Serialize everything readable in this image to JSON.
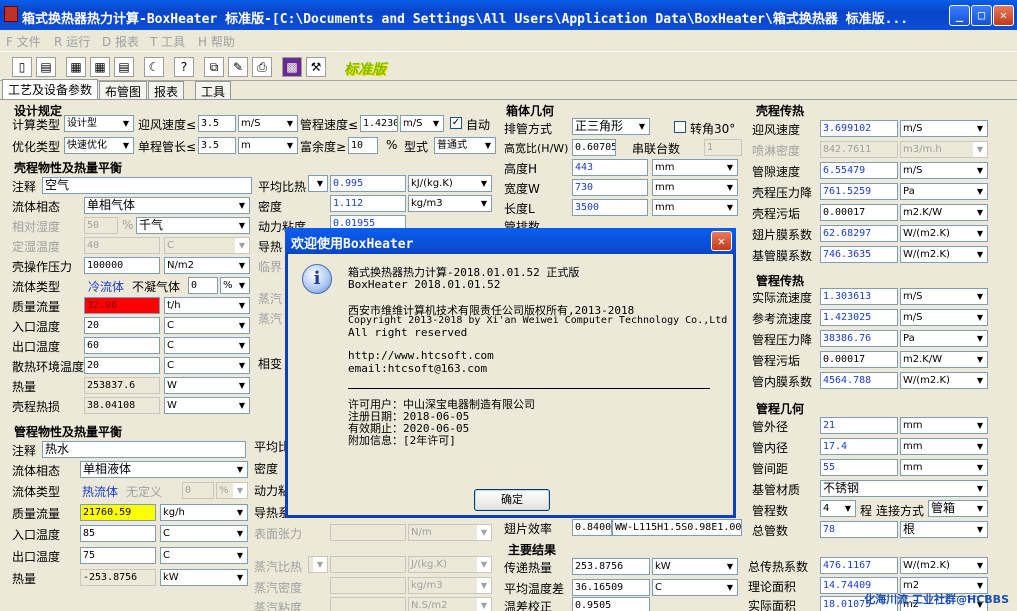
{
  "window": {
    "title": "箱式换热器热力计算-BoxHeater 标准版-[C:\\Documents and Settings\\All Users\\Application Data\\BoxHeater\\箱式换热器 标准版..."
  },
  "menu": [
    "F 文件",
    "R 运行",
    "D 报表",
    "T 工具",
    "H 帮助"
  ],
  "toolbar": {
    "badge": "标准版"
  },
  "tabs": [
    "工艺及设备参数",
    "布管图",
    "报表",
    "工具"
  ],
  "design": {
    "title": "设计规定",
    "calc_type_label": "计算类型",
    "calc_type": "设计型",
    "air_speed_label": "迎风速度≤",
    "air_speed": "3.5",
    "air_speed_unit": "m/S",
    "tube_speed_label": "管程速度≤",
    "tube_speed": "1.42302",
    "tube_speed_unit": "m/S",
    "auto_label": "自动",
    "auto_check": "✓",
    "opt_type_label": "优化类型",
    "opt_type": "快速优化",
    "single_len_label": "单程管长≤",
    "single_len": "3.5",
    "single_len_unit": "m",
    "margin_label": "富余度≥",
    "margin": "10",
    "margin_unit": "%",
    "model_label": "型式",
    "model": "普通式"
  },
  "shell": {
    "title": "壳程物性及热量平衡",
    "note_label": "注释",
    "note": "空气",
    "phase_label": "流体相态",
    "phase": "单相气体",
    "rh_label": "相对湿度",
    "rh": "50",
    "rh_unit": "%",
    "rh_sel": "千气",
    "fixed_temp_label": "定湿温度",
    "fixed_temp": "40",
    "fixed_temp_unit": "C",
    "pressure_label": "壳操作压力",
    "pressure": "100000",
    "pressure_unit": "N/m2",
    "fluid_type_label": "流体类型",
    "fluid_type": "冷流体",
    "noncond_label": "不凝气体",
    "noncond": "0",
    "noncond_unit": "%",
    "mass_flow_label": "质量流量",
    "mass_flow": "32.96",
    "mass_flow_unit": "t/h",
    "in_temp_label": "入口温度",
    "in_temp": "20",
    "in_temp_unit": "C",
    "out_temp_label": "出口温度",
    "out_temp": "60",
    "out_temp_unit": "C",
    "env_temp_label": "散热环境温度",
    "env_temp": "20",
    "env_temp_unit": "C",
    "heat_label": "热量",
    "heat": "253837.6",
    "heat_unit": "W",
    "loss_label": "壳程热损",
    "loss": "38.04108",
    "loss_unit": "W",
    "cp_label": "平均比热",
    "cp": "0.995",
    "cp_unit": "kJ/(kg.K)",
    "density_label": "密度",
    "density": "1.112",
    "density_unit": "kg/m3",
    "visc_label": "动力粘度",
    "visc": "0.01955",
    "cond_label": "导热",
    "crit_label": "临界",
    "steam1_label": "蒸汽",
    "steam2_label": "蒸汽",
    "phase_change_label": "相变"
  },
  "tube": {
    "title": "管程物性及热量平衡",
    "note_label": "注释",
    "note": "热水",
    "phase_label": "流体相态",
    "phase": "单相液体",
    "fluid_type_label": "流体类型",
    "fluid_type": "热流体",
    "undefined_label": "无定义",
    "undefined_val": "0",
    "undefined_unit": "%",
    "mass_flow_label": "质量流量",
    "mass_flow": "21760.59",
    "mass_flow_unit": "kg/h",
    "in_temp_label": "入口温度",
    "in_temp": "85",
    "in_temp_unit": "C",
    "out_temp_label": "出口温度",
    "out_temp": "75",
    "out_temp_unit": "C",
    "heat_label": "热量",
    "heat": "-253.8756",
    "heat_unit": "kW",
    "cp_label": "平均比",
    "density_label": "密度",
    "visc_label": "动力粘",
    "cond_label": "导热系",
    "surface_label": "表面张力",
    "surface_unit": "N/m",
    "steam_cp_label": "蒸汽比热",
    "steam_cp_unit": "J/(kg.K)",
    "steam_density_label": "蒸汽密度",
    "steam_density_unit": "kg/m3",
    "steam_visc_label": "蒸汽粘度",
    "steam_visc_unit": "N.S/m2"
  },
  "box": {
    "title": "箱体几何",
    "arrange_label": "排管方式",
    "arrange": "正三角形",
    "rotate_label": "转角30°",
    "ratio_label": "高宽比(H/W)",
    "ratio": "0.607051",
    "series_label": "串联台数",
    "series": "1",
    "height_label": "高度H",
    "height": "443",
    "height_unit": "mm",
    "width_label": "宽度W",
    "width": "730",
    "width_unit": "mm",
    "length_label": "长度L",
    "length": "3500",
    "length_unit": "mm",
    "rows_label": "管排数",
    "fin_eff_label": "翅片效率",
    "fin_eff": "0.8400",
    "fin_model": "WW-L115H1.5S0.98E1.00"
  },
  "shell_heat": {
    "title": "壳程传热",
    "air_speed_label": "迎风速度",
    "air_speed": "3.699102",
    "air_speed_unit": "m/S",
    "spray_label": "喷淋密度",
    "spray": "842.7611",
    "spray_unit": "m3/m.h",
    "gap_speed_label": "管隙速度",
    "gap_speed": "6.55479",
    "gap_speed_unit": "m/S",
    "dp_label": "壳程压力降",
    "dp": "761.5259",
    "dp_unit": "Pa",
    "fouling_label": "壳程污垢",
    "fouling": "0.00017",
    "fouling_unit": "m2.K/W",
    "fin_coef_label": "翅片膜系数",
    "fin_coef": "62.68297",
    "fin_coef_unit": "W/(m2.K)",
    "base_coef_label": "基管膜系数",
    "base_coef": "746.3635",
    "base_coef_unit": "W/(m2.K)"
  },
  "tube_heat": {
    "title": "管程传热",
    "act_speed_label": "实际流速度",
    "act_speed": "1.303613",
    "act_speed_unit": "m/S",
    "ref_speed_label": "参考流速度",
    "ref_speed": "1.423025",
    "ref_speed_unit": "m/S",
    "dp_label": "管程压力降",
    "dp": "38386.76",
    "dp_unit": "Pa",
    "fouling_label": "管程污垢",
    "fouling": "0.00017",
    "fouling_unit": "m2.K/W",
    "inner_coef_label": "管内膜系数",
    "inner_coef": "4564.788",
    "inner_coef_unit": "W/(m2.K)"
  },
  "tube_geom": {
    "title": "管程几何",
    "od_label": "管外径",
    "od": "21",
    "od_unit": "mm",
    "id_label": "管内径",
    "id": "17.4",
    "id_unit": "mm",
    "pitch_label": "管间距",
    "pitch": "55",
    "pitch_unit": "mm",
    "material_label": "基管材质",
    "material": "不锈钢",
    "passes_label": "管程数",
    "passes": "4",
    "passes_suffix": "程",
    "conn_label": "连接方式",
    "conn": "管箱",
    "total_label": "总管数",
    "total": "78",
    "total_unit": "根"
  },
  "results": {
    "title": "主要结果",
    "heat_label": "传递热量",
    "heat": "253.8756",
    "heat_unit": "kW",
    "lmtd_label": "平均温度差",
    "lmtd": "36.16509",
    "lmtd_unit": "C",
    "corr_label": "温差校正",
    "corr": "0.9505",
    "u_label": "总传热系数",
    "u": "476.1167",
    "u_unit": "W/(m2.K)",
    "area_theory_label": "理论面积",
    "area_theory": "14.74409",
    "area_theory_unit": "m2",
    "area_act_label": "实际面积",
    "area_act": "18.01075",
    "area_act_unit": "m2"
  },
  "dialog": {
    "title": "欢迎使用BoxHeater",
    "line1": "箱式换热器热力计算-2018.01.01.52 正式版",
    "line2": "BoxHeater 2018.01.01.52",
    "line3": "西安市维维计算机技术有限责任公司版权所有,2013-2018",
    "line4": "Copyright 2013-2018 by Xi'an Weiwei Computer Technology Co.,Ltd",
    "line5": "All right reserved",
    "line6": "http://www.htcsoft.com",
    "line7": "email:htcsoft@163.com",
    "line8": "许可用户：中山深宝电器制造有限公司",
    "line9": "注册日期：2018-06-05",
    "line10": "有效期止：2020-06-05",
    "line11": "附加信息：[2年许可]",
    "ok": "确定"
  },
  "watermark": "化海川流 工业社群@HCBBS"
}
